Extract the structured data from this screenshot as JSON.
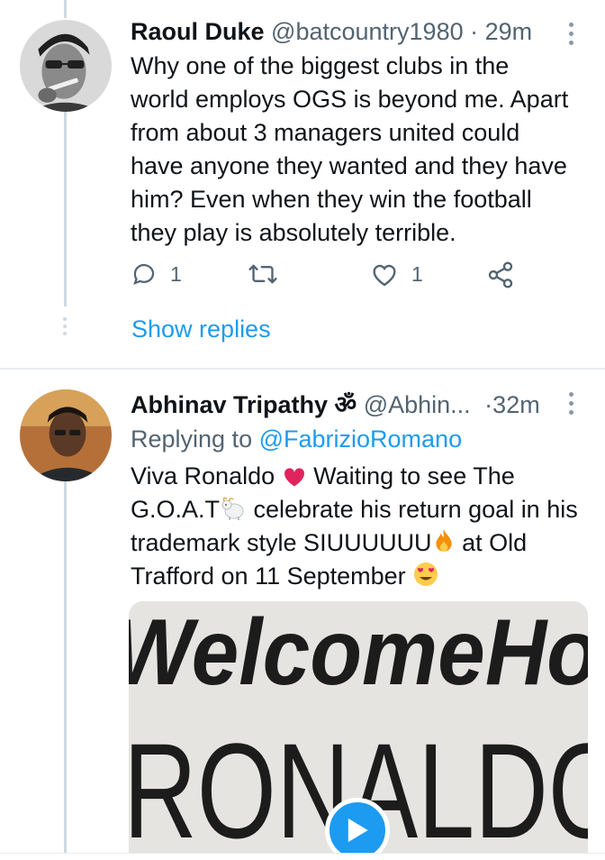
{
  "tweet1": {
    "display_name": "Raoul Duke",
    "handle": "@batcountry1980",
    "separator": "·",
    "time": "29m",
    "text_lines": [
      "Why one of the biggest clubs in the",
      "world employs OGS is beyond me. Apart",
      "from about 3 managers united could",
      "have anyone they wanted and they have",
      "him? Even when they win the football",
      "they play is absolutely terrible."
    ],
    "reply_count": "1",
    "like_count": "1",
    "icons": [
      "reply-icon",
      "retweet-icon",
      "like-icon",
      "share-icon",
      "more-icon"
    ]
  },
  "show_replies_label": "Show replies",
  "tweet2": {
    "display_name": "Abhinav Tripathy ॐ",
    "handle": "@Abhin...",
    "separator": "·",
    "time": "32m",
    "replying_prefix": "Replying to ",
    "replying_to": "@FabrizioRomano",
    "text_segments": {
      "line1_a": "Viva Ronaldo ",
      "line1_b": " Waiting to see The",
      "line2_a": "G.O.A.T",
      "line2_b": " celebrate his return goal in his",
      "line3_a": "trademark style SIUUUUUU",
      "line3_b": " at Old",
      "line4_a": "Trafford on 11 September "
    },
    "media_text_top": "WelcomeHo",
    "media_text_bottom": "RONALDO"
  },
  "colors": {
    "accent": "#1d9bf0",
    "muted": "#536471",
    "heart": "#e0245e"
  }
}
